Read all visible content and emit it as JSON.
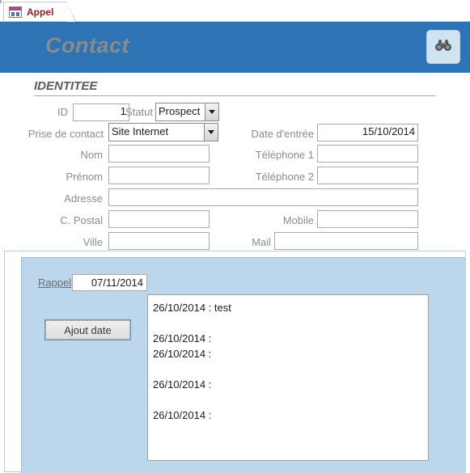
{
  "window": {
    "tab": {
      "label": "Appel",
      "icon": "access-form-icon"
    }
  },
  "header": {
    "title": "Contact",
    "find_button_icon": "binoculars-icon",
    "background_color": "#2e74b5",
    "title_color": "#8a8a8a",
    "find_button_color": "#cfe3f3"
  },
  "identity": {
    "section_title": "IDENTITEE",
    "fields": {
      "id": {
        "label": "ID",
        "value": "1"
      },
      "statut": {
        "label": "Statut",
        "value": "Prospect"
      },
      "prise_de_contact": {
        "label": "Prise de contact",
        "value": "Site Internet"
      },
      "date_entree": {
        "label": "Date d'entrée",
        "value": "15/10/2014"
      },
      "nom": {
        "label": "Nom",
        "value": ""
      },
      "telephone1": {
        "label": "Téléphone 1",
        "value": ""
      },
      "prenom": {
        "label": "Prénom",
        "value": ""
      },
      "telephone2": {
        "label": "Téléphone 2",
        "value": ""
      },
      "adresse": {
        "label": "Adresse",
        "value": ""
      },
      "code_postal": {
        "label": "C. Postal",
        "value": ""
      },
      "mobile": {
        "label": "Mobile",
        "value": ""
      },
      "ville": {
        "label": "Ville",
        "value": ""
      },
      "mail": {
        "label": "Mail",
        "value": ""
      }
    }
  },
  "rappel": {
    "label": "Rappel",
    "date_value": "07/11/2014",
    "add_date_button": "Ajout date",
    "panel_color": "#bcd6ec",
    "notes": "26/10/2014 : test\n\n26/10/2014 :\n26/10/2014 :\n\n26/10/2014 :\n\n26/10/2014 :"
  }
}
